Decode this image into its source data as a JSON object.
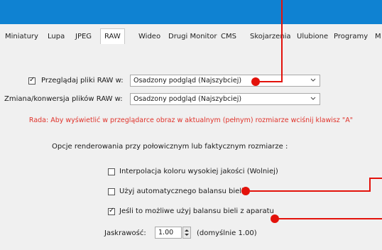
{
  "tabs": [
    {
      "label": "Miniatury"
    },
    {
      "label": "Lupa"
    },
    {
      "label": "JPEG"
    },
    {
      "label": "RAW"
    },
    {
      "label": "Wideo"
    },
    {
      "label": "Drugi Monitor"
    },
    {
      "label": "CMS"
    },
    {
      "label": "Skojarzenia"
    },
    {
      "label": "Ulubione"
    },
    {
      "label": "Programy"
    },
    {
      "label": "M"
    }
  ],
  "active_tab": "RAW",
  "raw_view": {
    "checked": true,
    "label": "Przeglądaj pliki RAW w:",
    "value": "Osadzony podgląd (Najszybciej)"
  },
  "raw_convert": {
    "label": "Zmiana/konwersja plików RAW w:",
    "value": "Osadzony podgląd (Najszybciej)"
  },
  "tip": "Rada: Aby wyświetlić w przeglądarce obraz w aktualnym (pełnym) rozmiarze wciśnij klawisz \"A\"",
  "render_options_heading": "Opcje renderowania przy połowicznym lub faktycznym rozmiarze :",
  "options": {
    "hq_interp": {
      "checked": false,
      "label": "Interpolacja koloru wysokiej jakości (Wolniej)"
    },
    "auto_wb": {
      "checked": false,
      "label": "Użyj automatycznego balansu bieli"
    },
    "camera_wb": {
      "checked": true,
      "label": "Jeśli to możliwe użyj balansu bieli z aparatu"
    }
  },
  "brightness": {
    "label": "Jaskrawość:",
    "value": "1.00",
    "default_note": "(domyślnie 1.00)"
  },
  "colors": {
    "title_bar": "#0f82d2",
    "annotation": "#e3120b",
    "tip_text": "#e0322a"
  }
}
